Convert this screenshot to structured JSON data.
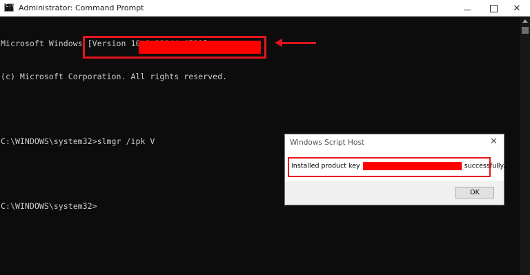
{
  "window": {
    "title": "Administrator: Command Prompt",
    "min_glyph": "",
    "close_glyph": "✕"
  },
  "console": {
    "lines": [
      "Microsoft Windows [Version 10.0.19044.4529]",
      "(c) Microsoft Corporation. All rights reserved.",
      "",
      "C:\\WINDOWS\\system32>slmgr /ipk V",
      "",
      "C:\\WINDOWS\\system32>"
    ]
  },
  "dialog": {
    "title": "Windows Script Host",
    "close_glyph": "✕",
    "message_prefix": "Installed product key",
    "message_suffix": "successfully.",
    "ok_label": "OK"
  },
  "colors": {
    "console_bg": "#0c0c0c",
    "console_text": "#cccccc",
    "redaction": "#ff0000",
    "highlight": "#e8141d"
  },
  "icons": {
    "app": "cmd-icon",
    "minimize": "minimize-icon",
    "maximize": "maximize-icon",
    "close": "close-icon",
    "arrow": "arrow-left-icon"
  }
}
